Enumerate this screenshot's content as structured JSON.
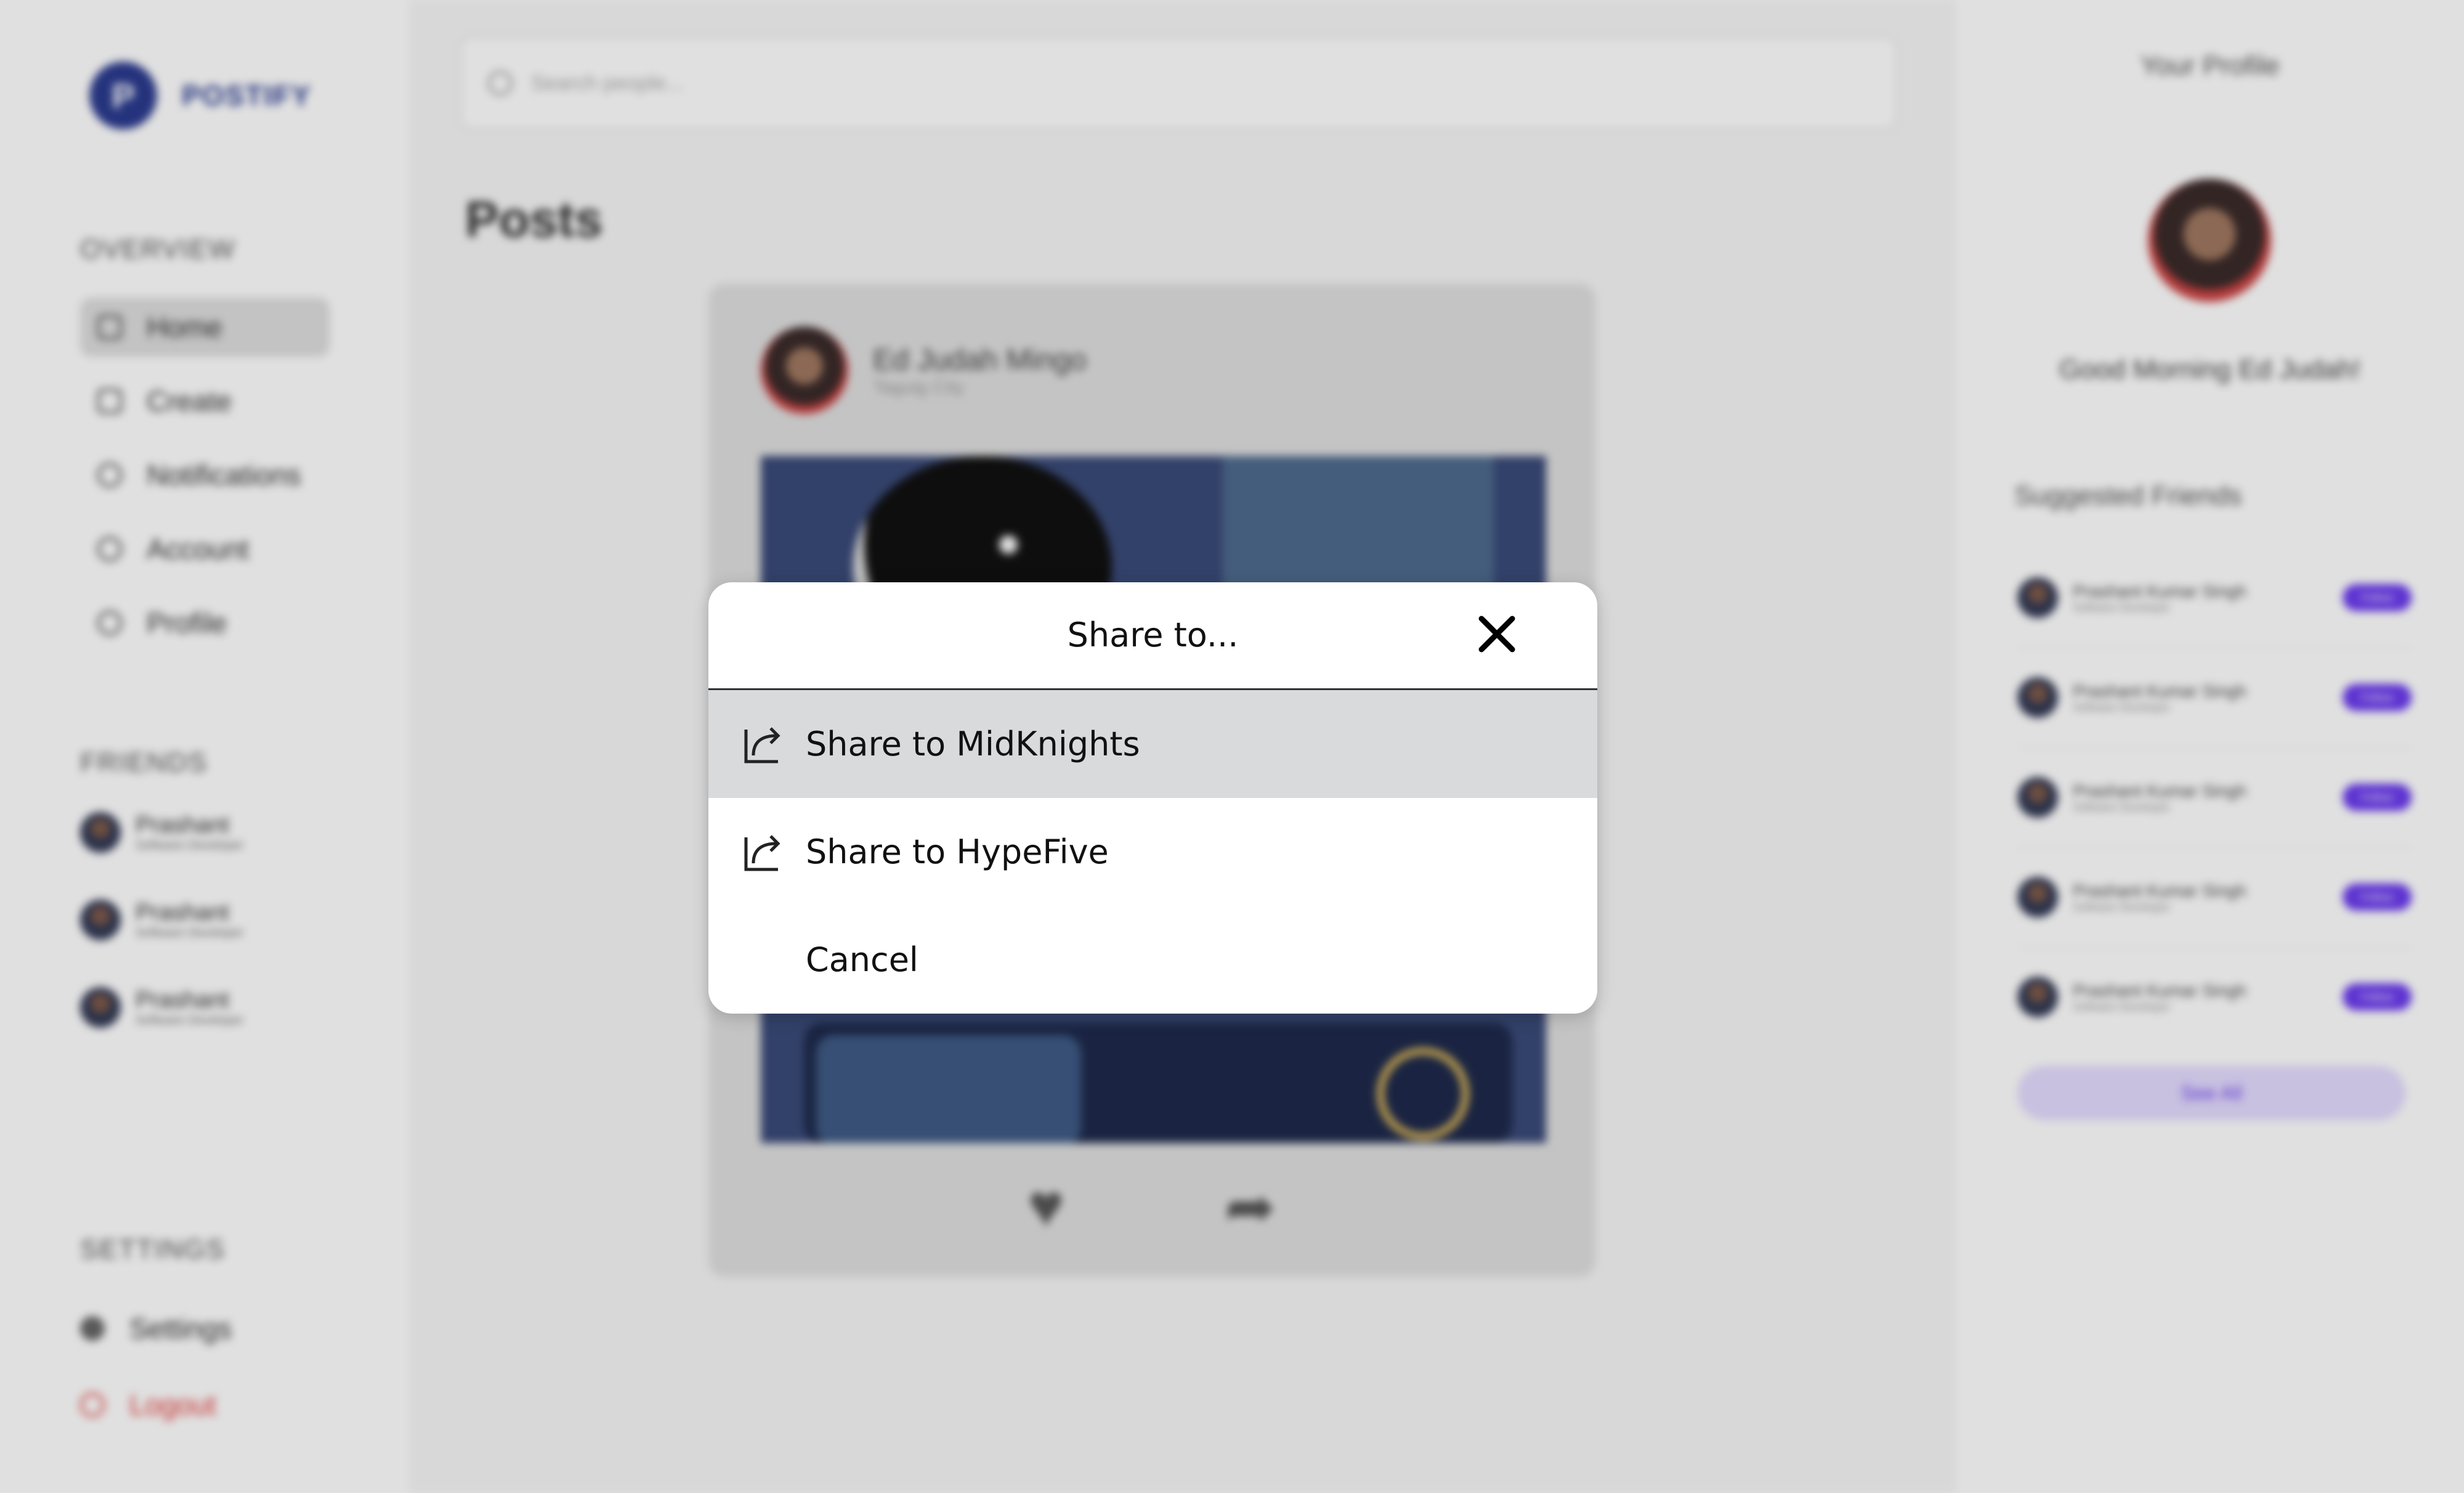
{
  "app": {
    "logo_text": "POSTIFY",
    "logo_glyph": "P"
  },
  "sidebar": {
    "overview_title": "OVERVIEW",
    "nav": [
      {
        "label": "Home",
        "icon": "home-icon",
        "active": true
      },
      {
        "label": "Create",
        "icon": "create-icon"
      },
      {
        "label": "Notifications",
        "icon": "bell-icon"
      },
      {
        "label": "Account",
        "icon": "user-icon"
      },
      {
        "label": "Profile",
        "icon": "profile-icon"
      }
    ],
    "friends_title": "FRIENDS",
    "friends": [
      {
        "name": "Prashant",
        "role": "Software Developer"
      },
      {
        "name": "Prashant",
        "role": "Software Developer"
      },
      {
        "name": "Prashant",
        "role": "Software Developer"
      }
    ],
    "settings_title": "SETTINGS",
    "settings_label": "Settings",
    "logout_label": "Logout"
  },
  "main": {
    "search_placeholder": "Search people...",
    "posts_title": "Posts",
    "post": {
      "author": "Ed Judah Mingo",
      "location": "Taguig City"
    }
  },
  "right_panel": {
    "title": "Your Profile",
    "greeting": "Good Morning Ed Judah!",
    "suggested_title": "Suggested Friends",
    "suggested": [
      {
        "name": "Prashant Kumar Singh",
        "role": "Software Developer",
        "button": "Follow"
      },
      {
        "name": "Prashant Kumar Singh",
        "role": "Software Developer",
        "button": "Follow"
      },
      {
        "name": "Prashant Kumar Singh",
        "role": "Software Developer",
        "button": "Follow"
      },
      {
        "name": "Prashant Kumar Singh",
        "role": "Software Developer",
        "button": "Follow"
      },
      {
        "name": "Prashant Kumar Singh",
        "role": "Software Developer",
        "button": "Follow"
      }
    ],
    "see_all_label": "See All"
  },
  "share_modal": {
    "title": "Share to...",
    "options": [
      {
        "label": "Share to MidKnights",
        "icon": "share-icon",
        "highlighted": true
      },
      {
        "label": "Share to HypeFive",
        "icon": "share-icon",
        "highlighted": false
      }
    ],
    "cancel_label": "Cancel"
  },
  "colors": {
    "brand": "#2b3b8f",
    "accent": "#6b3bef",
    "logout": "#e23b3b",
    "row_highlight": "#d9dadb"
  }
}
